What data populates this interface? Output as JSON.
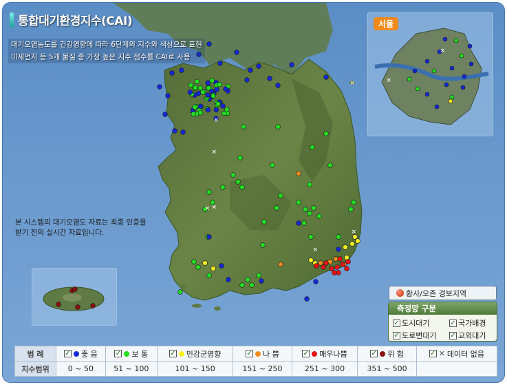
{
  "title": "통합대기환경지수(CAI)",
  "description": {
    "line1": "대기오염농도를 건강영향에 따라 6단계의 지수와 색상으로 표현",
    "line2": "미세먼지 등 5개 물질 중 가장 높은 지수 점수를 CAI로 사용"
  },
  "notice": {
    "line1": "본 시스템의 대기오염도 자료는 최종 인증을",
    "line2": "받기 전의 실시간 자료입니다."
  },
  "seoul_inset": {
    "label": "서울"
  },
  "warning_button": {
    "label": "황사/오존 경보지역"
  },
  "network_panel": {
    "title": "측정망 구분",
    "items": [
      {
        "label": "도시대기",
        "checked": true
      },
      {
        "label": "국가배경",
        "checked": true
      },
      {
        "label": "도로변대기",
        "checked": true
      },
      {
        "label": "교외대기",
        "checked": true
      }
    ]
  },
  "legend": {
    "header_label": "범 례",
    "range_label": "지수범위",
    "entries": [
      {
        "label": "좋 음",
        "range": "0 ~ 50",
        "color": "#1428d8"
      },
      {
        "label": "보 통",
        "range": "51 ~ 100",
        "color": "#22dd22"
      },
      {
        "label": "민감군영향",
        "range": "101 ~ 150",
        "color": "#f5ef1e"
      },
      {
        "label": "나 쁨",
        "range": "151 ~ 250",
        "color": "#f08c1e"
      },
      {
        "label": "매우나쁨",
        "range": "251 ~ 300",
        "color": "#ee1111"
      },
      {
        "label": "위 험",
        "range": "351 ~ 500",
        "color": "#8a1010"
      },
      {
        "label": "데이터 없음",
        "range": "",
        "color": "none"
      }
    ]
  },
  "station_colors": {
    "good": "#1428d8",
    "moderate": "#22dd22",
    "sensitive": "#f5ef1e",
    "unhealthy": "#f08c1e",
    "very_unhealthy": "#ee1111",
    "hazardous": "#8a1010"
  }
}
